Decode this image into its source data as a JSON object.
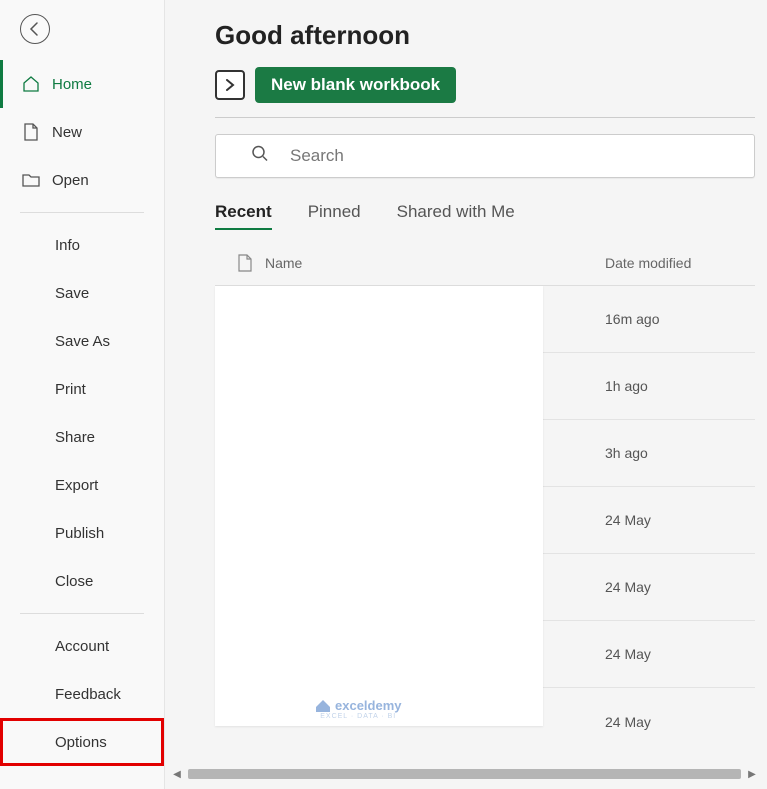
{
  "sidebar": {
    "home": "Home",
    "new": "New",
    "open": "Open",
    "info": "Info",
    "save": "Save",
    "save_as": "Save As",
    "print": "Print",
    "share": "Share",
    "export": "Export",
    "publish": "Publish",
    "close": "Close",
    "account": "Account",
    "feedback": "Feedback",
    "options": "Options"
  },
  "main": {
    "greeting": "Good afternoon",
    "new_blank": "New blank workbook",
    "search_placeholder": "Search",
    "tabs": {
      "recent": "Recent",
      "pinned": "Pinned",
      "shared": "Shared with Me"
    },
    "header": {
      "name": "Name",
      "date": "Date modified"
    },
    "rows": [
      {
        "date": "16m ago"
      },
      {
        "date": "1h ago"
      },
      {
        "date": "3h ago"
      },
      {
        "date": "24 May"
      },
      {
        "date": "24 May"
      },
      {
        "date": "24 May"
      },
      {
        "date": "24 May"
      }
    ]
  },
  "watermark": {
    "brand": "exceldemy",
    "sub": "EXCEL · DATA · BI"
  },
  "colors": {
    "accent": "#0f7b42",
    "highlight": "#e20000"
  }
}
